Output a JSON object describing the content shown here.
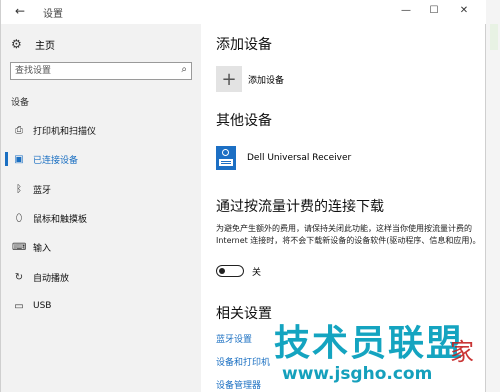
{
  "window": {
    "back_icon": "arrow-left-icon",
    "title": "设置",
    "minimize": "—",
    "maximize": "☐",
    "close": "✕"
  },
  "sidebar": {
    "home_icon": "gear-icon",
    "home_label": "主页",
    "search_placeholder": "查找设置",
    "search_icon": "search-icon",
    "section_label": "设备",
    "items": [
      {
        "label": "打印机和扫描仪",
        "icon": "printer-icon",
        "active": false
      },
      {
        "label": "已连接设备",
        "icon": "connected-devices-icon",
        "active": true
      },
      {
        "label": "蓝牙",
        "icon": "bluetooth-icon",
        "active": false
      },
      {
        "label": "鼠标和触摸板",
        "icon": "mouse-icon",
        "active": false
      },
      {
        "label": "输入",
        "icon": "keyboard-icon",
        "active": false
      },
      {
        "label": "自动播放",
        "icon": "autoplay-icon",
        "active": false
      },
      {
        "label": "USB",
        "icon": "usb-icon",
        "active": false
      }
    ]
  },
  "main": {
    "add_heading": "添加设备",
    "add_label": "添加设备",
    "other_heading": "其他设备",
    "device_name": "Dell Universal Receiver",
    "metered_heading": "通过按流量计费的连接下载",
    "metered_desc": "为避免产生额外的费用，请保持关闭此功能，这样当你使用按流量计费的 Internet 连接时，将不会下载新设备的设备软件(驱动程序、信息和应用)。",
    "toggle_state": "关",
    "related_heading": "相关设置",
    "links": [
      "蓝牙设置",
      "设备和打印机",
      "设备管理器"
    ]
  },
  "watermark": {
    "main": "技术员联盟",
    "url": "www.jsgho.com",
    "seal_text": "家"
  }
}
